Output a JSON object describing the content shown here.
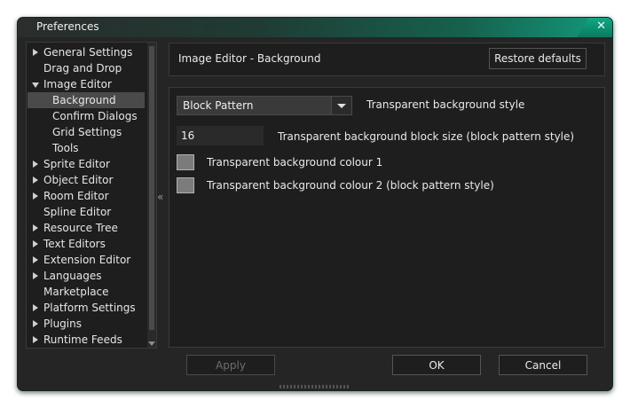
{
  "window": {
    "title": "Preferences",
    "close_glyph": "✕"
  },
  "tree": {
    "items": [
      {
        "label": "General Settings",
        "expandable": true,
        "expanded": false,
        "level": 0
      },
      {
        "label": "Drag and Drop",
        "expandable": false,
        "level": 0
      },
      {
        "label": "Image Editor",
        "expandable": true,
        "expanded": true,
        "level": 0
      },
      {
        "label": "Background",
        "expandable": false,
        "level": 1,
        "selected": true
      },
      {
        "label": "Confirm Dialogs",
        "expandable": false,
        "level": 1
      },
      {
        "label": "Grid Settings",
        "expandable": false,
        "level": 1
      },
      {
        "label": "Tools",
        "expandable": false,
        "level": 1
      },
      {
        "label": "Sprite Editor",
        "expandable": true,
        "expanded": false,
        "level": 0
      },
      {
        "label": "Object Editor",
        "expandable": true,
        "expanded": false,
        "level": 0
      },
      {
        "label": "Room Editor",
        "expandable": true,
        "expanded": false,
        "level": 0
      },
      {
        "label": "Spline Editor",
        "expandable": false,
        "level": 0
      },
      {
        "label": "Resource Tree",
        "expandable": true,
        "expanded": false,
        "level": 0
      },
      {
        "label": "Text Editors",
        "expandable": true,
        "expanded": false,
        "level": 0
      },
      {
        "label": "Extension Editor",
        "expandable": true,
        "expanded": false,
        "level": 0
      },
      {
        "label": "Languages",
        "expandable": true,
        "expanded": false,
        "level": 0
      },
      {
        "label": "Marketplace",
        "expandable": false,
        "level": 0
      },
      {
        "label": "Platform Settings",
        "expandable": true,
        "expanded": false,
        "level": 0
      },
      {
        "label": "Plugins",
        "expandable": true,
        "expanded": false,
        "level": 0
      },
      {
        "label": "Runtime Feeds",
        "expandable": true,
        "expanded": false,
        "level": 0
      }
    ]
  },
  "splitter_glyph": "«",
  "header": {
    "title": "Image Editor - Background",
    "restore_label": "Restore defaults"
  },
  "settings": {
    "style_value": "Block Pattern",
    "style_label": "Transparent background style",
    "block_size_value": "16",
    "block_size_label": "Transparent background block size (block pattern style)",
    "colour1_label": "Transparent background colour 1",
    "colour2_label": "Transparent background colour 2 (block pattern style)",
    "colour1": "#7b7b7b",
    "colour2": "#7b7b7b"
  },
  "footer": {
    "apply_label": "Apply",
    "ok_label": "OK",
    "cancel_label": "Cancel"
  },
  "colors": {
    "accent": "#139a7a",
    "background": "#252525",
    "panel": "#1e1e1e"
  }
}
